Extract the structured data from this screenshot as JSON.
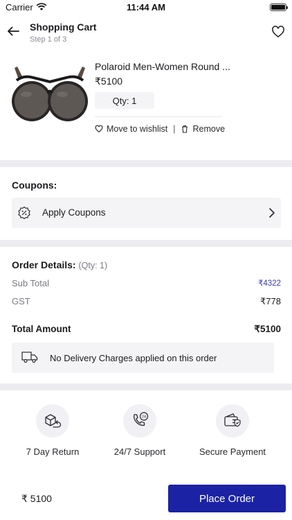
{
  "status_bar": {
    "carrier": "Carrier",
    "time": "11:44 AM"
  },
  "header": {
    "title": "Shopping Cart",
    "subtitle": "Step 1 of 3"
  },
  "product": {
    "name": "Polaroid Men-Women Round ...",
    "price": "₹5100",
    "qty": "Qty: 1",
    "move_to_wishlist": "Move to wishlist",
    "separator": "|",
    "remove": "Remove"
  },
  "coupons": {
    "title": "Coupons:",
    "apply_label": "Apply Coupons"
  },
  "order_details": {
    "title": "Order Details:",
    "qty": "(Qty: 1)",
    "rows": [
      {
        "label": "Sub Total",
        "value": "₹4322"
      },
      {
        "label": "GST",
        "value": "₹778"
      }
    ],
    "total_label": "Total Amount",
    "total_value": "₹5100",
    "delivery_note": "No Delivery Charges applied on this order"
  },
  "features": [
    {
      "label": "7 Day Return",
      "icon": "return-box-icon"
    },
    {
      "label": "24/7 Support",
      "icon": "support-phone-icon"
    },
    {
      "label": "Secure Payment",
      "icon": "secure-wallet-icon"
    }
  ],
  "footer": {
    "price": "₹ 5100",
    "place_order_label": "Place Order"
  },
  "colors": {
    "accent": "#1b22a4",
    "subtotal_value": "#3a3aa8",
    "section_band": "#ececf1",
    "panel_bg": "#f4f4f7"
  }
}
